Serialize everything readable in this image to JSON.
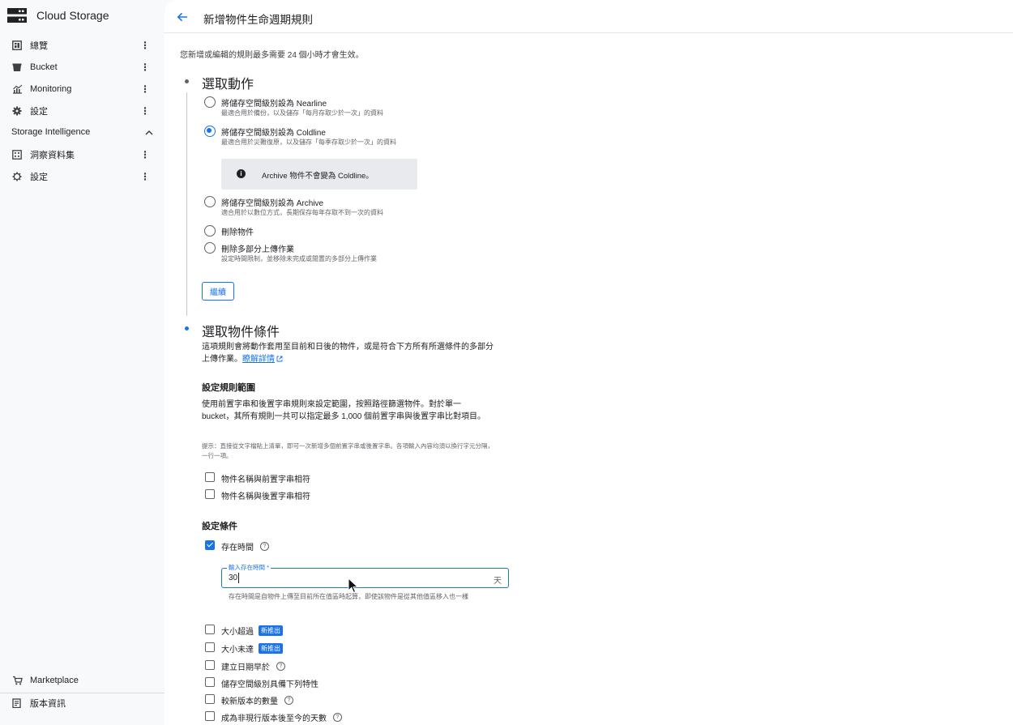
{
  "app": {
    "title": "Cloud Storage",
    "logo_icon": "cloud-storage-logo-icon"
  },
  "sidebar": {
    "items": [
      {
        "label": "總覽",
        "icon": "overview-icon"
      },
      {
        "label": "Bucket",
        "icon": "bucket-icon"
      },
      {
        "label": "Monitoring",
        "icon": "monitoring-icon"
      },
      {
        "label": "設定",
        "icon": "gear-icon"
      }
    ],
    "section": {
      "label": "Storage Intelligence",
      "icon": "chevron-up-icon"
    },
    "section_items": [
      {
        "label": "洞察資料集",
        "icon": "dataset-icon"
      },
      {
        "label": "設定",
        "icon": "settings-icon"
      }
    ],
    "footer_items": [
      {
        "label": "Marketplace",
        "icon": "marketplace-icon"
      },
      {
        "label": "版本資訊",
        "icon": "release-notes-icon"
      }
    ],
    "more_glyph": "⋮"
  },
  "header": {
    "back_icon": "arrow-left-icon",
    "title": "新增物件生命週期規則"
  },
  "notice": "您新增或編輯的規則最多需要 24 個小時才會生效。",
  "step1": {
    "title": "選取動作",
    "options": [
      {
        "label": "將儲存空間級別設為 Nearline",
        "desc": "最適合用於備份，以及儲存「每月存取少於一次」的資料",
        "selected": false
      },
      {
        "label": "將儲存空間級別設為 Coldline",
        "desc": "最適合用於災難復原，以及儲存「每季存取少於一次」的資料",
        "selected": true
      },
      {
        "label": "將儲存空間級別設為 Archive",
        "desc": "適合用於以數位方式，長期保存每年存取不到一次的資料",
        "selected": false
      },
      {
        "label": "刪除物件",
        "desc": "",
        "selected": false
      },
      {
        "label": "刪除多部分上傳作業",
        "desc": "設定時間限制，並移除未完成或閒置的多部分上傳作業",
        "selected": false
      }
    ],
    "info": "Archive 物件不會變為 Coldline。",
    "continue_label": "繼續"
  },
  "step2": {
    "title": "選取物件條件",
    "intro": "這項規則會將動作套用至目前和日後的物件，或是符合下方所有所選條件的多部分上傳作業。",
    "learn_more": "瞭解詳情",
    "scope": {
      "heading": "設定規則範圍",
      "desc": "使用前置字串和後置字串規則來設定範圍，按照路徑篩選物件。對於單一 bucket，其所有規則一共可以指定最多 1,000 個前置字串與後置字串比對項目。",
      "hint": "提示：直接從文字檔貼上清單，即可一次新增多個前置字串或後置字串。各項輸入內容均須以換行字元分隔，一行一項。",
      "checks": [
        {
          "label": "物件名稱與前置字串相符",
          "checked": false
        },
        {
          "label": "物件名稱與後置字串相符",
          "checked": false
        }
      ]
    },
    "conditions": {
      "heading": "設定條件",
      "age": {
        "label": "存在時間",
        "checked": true,
        "field_label": "輸入存在時間 *",
        "field_value": "30",
        "unit": "天",
        "helper": "存在時間是自物件上傳至目前所在值區時起算，即使該物件是從其他值區移入也一樣"
      },
      "others": [
        {
          "label": "大小超過",
          "badge": "新推出",
          "help": false
        },
        {
          "label": "大小未達",
          "badge": "新推出",
          "help": false
        },
        {
          "label": "建立日期早於",
          "badge": "",
          "help": true
        },
        {
          "label": "儲存空間級別具備下列特性",
          "badge": "",
          "help": false
        },
        {
          "label": "較新版本的數量",
          "badge": "",
          "help": true
        },
        {
          "label": "成為非現行版本後至今的天數",
          "badge": "",
          "help": true
        }
      ]
    }
  },
  "colors": {
    "accent": "#1a73e8",
    "sidebar_bg": "#f8f9fb",
    "text": "#202124",
    "muted": "#5f6368"
  }
}
